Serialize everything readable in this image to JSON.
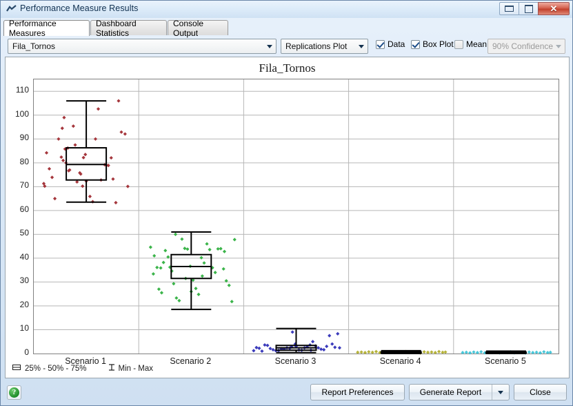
{
  "window": {
    "title": "Performance Measure Results",
    "icon": "chart-icon",
    "buttons": {
      "minimize": "minimize-icon",
      "maximize": "maximize-icon",
      "close": "✕"
    }
  },
  "tabs": [
    {
      "label": "Performance Measures",
      "active": true
    },
    {
      "label": "Dashboard Statistics",
      "active": false
    },
    {
      "label": "Console Output",
      "active": false
    }
  ],
  "toolbar": {
    "measure_select": "Fila_Tornos",
    "plot_type_select": "Replications Plot",
    "checkboxes": [
      {
        "label": "Data",
        "checked": true
      },
      {
        "label": "Box Plot",
        "checked": true
      },
      {
        "label": "Mean",
        "checked": false
      }
    ],
    "confidence_select": "90% Confidence",
    "confidence_disabled": true
  },
  "footer": {
    "help_label": "?",
    "report_preferences": "Report Preferences",
    "generate_report": "Generate Report",
    "close": "Close"
  },
  "legend": {
    "box_icon": "box-plot-icon",
    "box_label": "25% - 50% - 75%",
    "whisker_icon": "min-max-icon",
    "whisker_label": "Min - Max"
  },
  "colors": {
    "scenario1": "#a5363c",
    "scenario2": "#3bb44a",
    "scenario3": "#3b3bbb",
    "scenario4": "#b5b23a",
    "scenario5": "#49c6d8",
    "grid": "#b6b6b6",
    "box": "#000000",
    "accent": "#1d4e89"
  },
  "chart_data": {
    "type": "scatter",
    "title": "Fila_Tornos",
    "xlabel": "",
    "ylabel": "",
    "grid": true,
    "legend_position": "bottom-left",
    "ylim": [
      0,
      115
    ],
    "yticks": [
      0,
      10,
      20,
      30,
      40,
      50,
      60,
      70,
      80,
      90,
      100,
      110
    ],
    "categories": [
      "Scenario 1",
      "Scenario 2",
      "Scenario 3",
      "Scenario 4",
      "Scenario 5"
    ],
    "boxes": [
      {
        "category": "Scenario 1",
        "min": 63.5,
        "q1": 72.8,
        "median": 79.3,
        "q3": 86.3,
        "max": 106.0
      },
      {
        "category": "Scenario 2",
        "min": 18.5,
        "q1": 31.5,
        "median": 36.5,
        "q3": 41.5,
        "max": 51.0
      },
      {
        "category": "Scenario 3",
        "min": 0.4,
        "q1": 1.4,
        "median": 2.4,
        "q3": 3.4,
        "max": 10.5
      },
      {
        "category": "Scenario 4",
        "min": 0.0,
        "q1": 0.3,
        "median": 0.5,
        "q3": 0.7,
        "max": 1.2
      },
      {
        "category": "Scenario 5",
        "min": 0.0,
        "q1": 0.2,
        "median": 0.4,
        "q3": 0.6,
        "max": 1.0
      }
    ],
    "series": [
      {
        "name": "Scenario 1",
        "color": "#a5363c",
        "points": [
          [
            0.07,
            84.2
          ],
          [
            0.04,
            71.3
          ],
          [
            0.05,
            70.2
          ],
          [
            0.1,
            77.5
          ],
          [
            0.13,
            73.9
          ],
          [
            0.16,
            65.0
          ],
          [
            0.2,
            90.0
          ],
          [
            0.24,
            94.5
          ],
          [
            0.26,
            99.0
          ],
          [
            0.23,
            82.4
          ],
          [
            0.27,
            85.8
          ],
          [
            0.3,
            86.2
          ],
          [
            0.28,
            80.0
          ],
          [
            0.25,
            81.0
          ],
          [
            0.31,
            76.7
          ],
          [
            0.32,
            77.0
          ],
          [
            0.36,
            95.4
          ],
          [
            0.38,
            87.5
          ],
          [
            0.4,
            72.0
          ],
          [
            0.44,
            75.3
          ],
          [
            0.43,
            75.8
          ],
          [
            0.47,
            82.2
          ],
          [
            0.49,
            83.5
          ],
          [
            0.46,
            70.2
          ],
          [
            0.5,
            72.3
          ],
          [
            0.54,
            65.9
          ],
          [
            0.57,
            63.7
          ],
          [
            0.6,
            90.0
          ],
          [
            0.63,
            102.6
          ],
          [
            0.66,
            72.8
          ],
          [
            0.7,
            79.2
          ],
          [
            0.72,
            79.0
          ],
          [
            0.74,
            78.9
          ],
          [
            0.77,
            82.1
          ],
          [
            0.79,
            73.2
          ],
          [
            0.82,
            63.3
          ],
          [
            0.85,
            106.0
          ],
          [
            0.88,
            92.9
          ],
          [
            0.92,
            92.1
          ],
          [
            0.95,
            70.1
          ]
        ]
      },
      {
        "name": "Scenario 2",
        "color": "#3bb44a",
        "points": [
          [
            0.06,
            44.6
          ],
          [
            0.1,
            41.0
          ],
          [
            0.13,
            36.1
          ],
          [
            0.09,
            33.4
          ],
          [
            0.17,
            35.9
          ],
          [
            0.2,
            38.2
          ],
          [
            0.22,
            43.2
          ],
          [
            0.25,
            40.5
          ],
          [
            0.27,
            36.2
          ],
          [
            0.29,
            34.6
          ],
          [
            0.31,
            29.3
          ],
          [
            0.34,
            23.3
          ],
          [
            0.37,
            22.2
          ],
          [
            0.33,
            50.0
          ],
          [
            0.4,
            48.0
          ],
          [
            0.43,
            44.1
          ],
          [
            0.46,
            43.8
          ],
          [
            0.49,
            36.6
          ],
          [
            0.44,
            31.5
          ],
          [
            0.52,
            30.8
          ],
          [
            0.55,
            27.3
          ],
          [
            0.5,
            26.0
          ],
          [
            0.58,
            24.8
          ],
          [
            0.61,
            40.2
          ],
          [
            0.64,
            38.0
          ],
          [
            0.67,
            46.0
          ],
          [
            0.7,
            43.6
          ],
          [
            0.73,
            36.0
          ],
          [
            0.76,
            34.0
          ],
          [
            0.79,
            43.9
          ],
          [
            0.82,
            44.0
          ],
          [
            0.85,
            35.5
          ],
          [
            0.88,
            30.5
          ],
          [
            0.91,
            28.6
          ],
          [
            0.94,
            21.8
          ],
          [
            0.97,
            47.8
          ],
          [
            0.15,
            27.0
          ],
          [
            0.18,
            25.5
          ],
          [
            0.62,
            32.5
          ],
          [
            0.86,
            42.8
          ]
        ]
      },
      {
        "name": "Scenario 3",
        "color": "#3b3bbb",
        "points": [
          [
            0.04,
            1.2
          ],
          [
            0.07,
            2.5
          ],
          [
            0.1,
            2.2
          ],
          [
            0.13,
            1.0
          ],
          [
            0.16,
            3.6
          ],
          [
            0.19,
            3.4
          ],
          [
            0.22,
            2.1
          ],
          [
            0.25,
            1.6
          ],
          [
            0.28,
            1.2
          ],
          [
            0.31,
            1.3
          ],
          [
            0.34,
            2.0
          ],
          [
            0.37,
            1.9
          ],
          [
            0.4,
            2.4
          ],
          [
            0.43,
            2.2
          ],
          [
            0.46,
            9.0
          ],
          [
            0.49,
            4.0
          ],
          [
            0.5,
            3.0
          ],
          [
            0.53,
            1.5
          ],
          [
            0.56,
            1.4
          ],
          [
            0.59,
            2.4
          ],
          [
            0.62,
            2.8
          ],
          [
            0.65,
            3.6
          ],
          [
            0.68,
            5.0
          ],
          [
            0.71,
            3.2
          ],
          [
            0.74,
            2.4
          ],
          [
            0.77,
            1.8
          ],
          [
            0.8,
            1.6
          ],
          [
            0.83,
            3.0
          ],
          [
            0.86,
            7.5
          ],
          [
            0.89,
            4.0
          ],
          [
            0.92,
            2.6
          ],
          [
            0.95,
            8.3
          ],
          [
            0.97,
            2.4
          ],
          [
            0.45,
            2.8
          ],
          [
            0.66,
            1.4
          ]
        ]
      },
      {
        "name": "Scenario 4",
        "color": "#b5b23a",
        "points": [
          [
            0.03,
            0.5
          ],
          [
            0.07,
            0.6
          ],
          [
            0.11,
            0.4
          ],
          [
            0.15,
            0.7
          ],
          [
            0.19,
            0.5
          ],
          [
            0.23,
            0.8
          ],
          [
            0.27,
            0.4
          ],
          [
            0.31,
            0.6
          ],
          [
            0.35,
            0.5
          ],
          [
            0.39,
            0.7
          ],
          [
            0.43,
            0.4
          ],
          [
            0.47,
            0.6
          ],
          [
            0.51,
            0.5
          ],
          [
            0.55,
            0.8
          ],
          [
            0.59,
            0.4
          ],
          [
            0.63,
            0.6
          ],
          [
            0.67,
            0.5
          ],
          [
            0.71,
            0.2
          ],
          [
            0.75,
            0.7
          ],
          [
            0.79,
            0.5
          ],
          [
            0.83,
            0.6
          ],
          [
            0.87,
            0.4
          ],
          [
            0.91,
            0.8
          ],
          [
            0.95,
            0.5
          ],
          [
            0.98,
            0.6
          ]
        ]
      },
      {
        "name": "Scenario 5",
        "color": "#49c6d8",
        "points": [
          [
            0.03,
            0.4
          ],
          [
            0.07,
            0.5
          ],
          [
            0.11,
            0.3
          ],
          [
            0.15,
            0.6
          ],
          [
            0.19,
            0.4
          ],
          [
            0.23,
            0.7
          ],
          [
            0.27,
            0.3
          ],
          [
            0.31,
            0.5
          ],
          [
            0.35,
            0.4
          ],
          [
            0.39,
            0.6
          ],
          [
            0.43,
            0.3
          ],
          [
            0.47,
            0.5
          ],
          [
            0.51,
            0.4
          ],
          [
            0.55,
            0.7
          ],
          [
            0.59,
            0.3
          ],
          [
            0.63,
            0.5
          ],
          [
            0.67,
            0.4
          ],
          [
            0.71,
            0.2
          ],
          [
            0.75,
            0.6
          ],
          [
            0.79,
            0.4
          ],
          [
            0.83,
            0.5
          ],
          [
            0.87,
            0.3
          ],
          [
            0.91,
            0.7
          ],
          [
            0.95,
            0.4
          ],
          [
            0.98,
            0.5
          ]
        ]
      }
    ]
  }
}
